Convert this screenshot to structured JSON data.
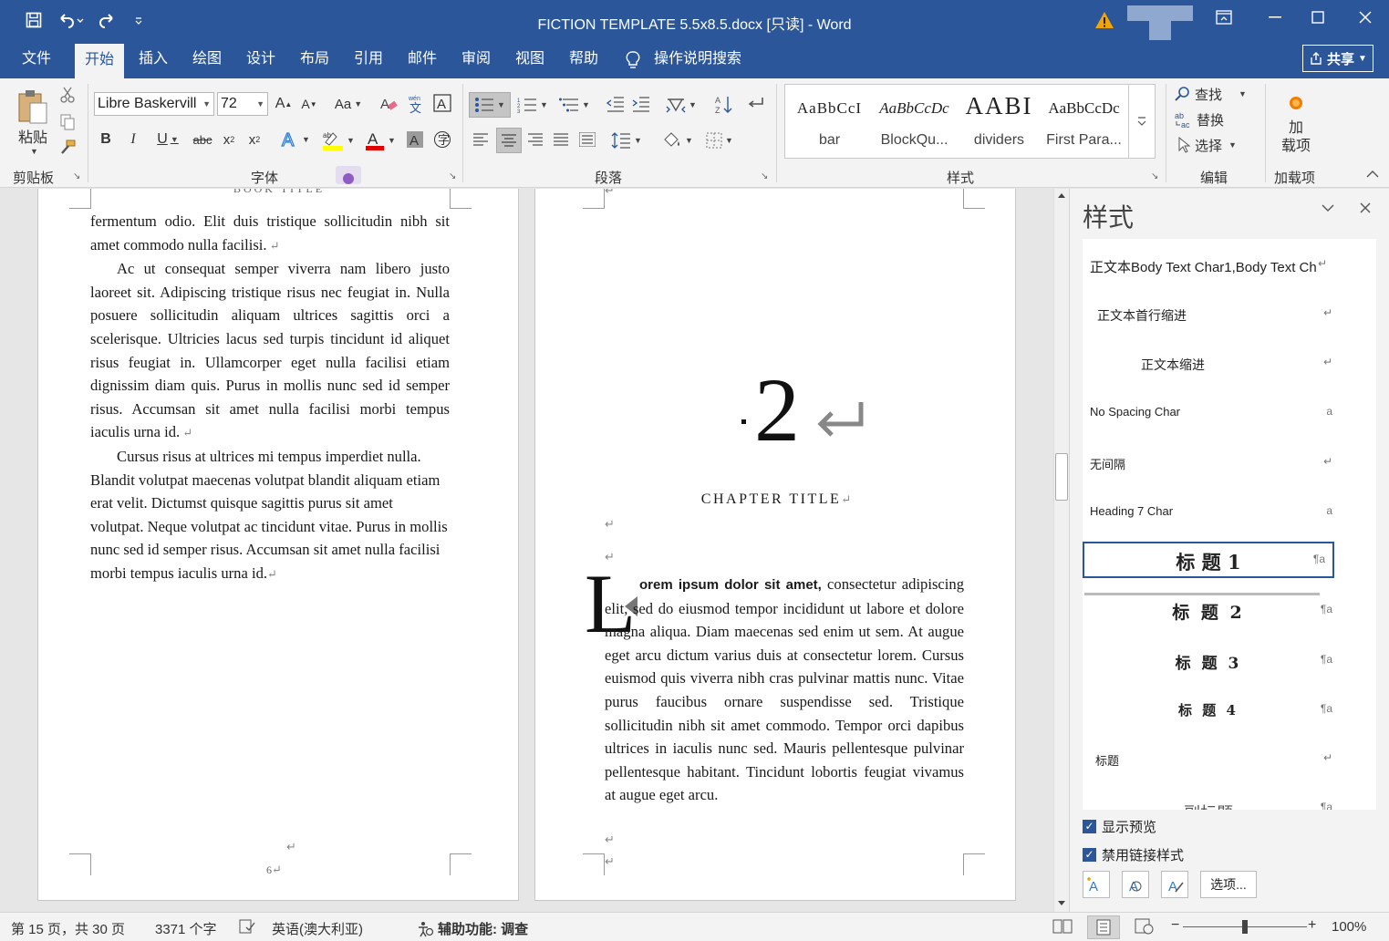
{
  "titlebar": {
    "title": "FICTION TEMPLATE 5.5x8.5.docx [只读]  -  Word",
    "qat": [
      "save-icon",
      "undo-icon",
      "redo-icon",
      "customize-icon"
    ],
    "accent": "#2b579a",
    "warning_color": "#f0a30a"
  },
  "tabs": [
    "文件",
    "开始",
    "插入",
    "绘图",
    "设计",
    "布局",
    "引用",
    "邮件",
    "审阅",
    "视图",
    "帮助"
  ],
  "active_tab": "开始",
  "tell_me": "操作说明搜索",
  "share": "共享",
  "ribbon": {
    "clipboard": {
      "label": "剪贴板",
      "paste": "粘贴"
    },
    "font": {
      "label": "字体",
      "font_name": "Libre Baskervill",
      "font_size": "72"
    },
    "paragraph": {
      "label": "段落"
    },
    "styles": {
      "label": "样式",
      "gallery": [
        {
          "preview": "AaBbCcI",
          "name": "bar"
        },
        {
          "preview": "AaBbCcDc",
          "name": "BlockQu..."
        },
        {
          "preview": "AABI",
          "name": "dividers"
        },
        {
          "preview": "AaBbCcDc",
          "name": "First Para..."
        }
      ]
    },
    "editing": {
      "label": "编辑",
      "find": "查找",
      "replace": "替换",
      "select": "选择"
    },
    "addins": {
      "label": "加载项",
      "button": "加\n载项"
    }
  },
  "page_left": {
    "header": "BOOK TITLE",
    "p1": "fermentum odio. Elit duis tristique sollicitudin nibh sit amet commodo nulla facilisi.",
    "p2": "Ac ut consequat semper viverra nam libero justo laoreet sit. Adipiscing tristique risus nec feugiat in. Nulla posuere sollicitudin aliquam ultrices sagittis orci a scelerisque. Ultricies lacus sed turpis tincidunt id aliquet risus feugiat in. Ullamcorper eget nulla facilisi etiam dignissim diam quis. Purus in mollis nunc sed id semper risus. Accumsan sit amet nulla facilisi morbi tempus iaculis urna id.",
    "p3": "Cursus risus at ultrices mi tempus imperdiet nulla. Blandit volutpat maecenas volutpat blandit aliquam etiam erat velit. Dictumst quisque sagittis purus sit amet volutpat. Neque volutpat ac tincidunt vitae. Purus in mollis nunc sed id semper risus. Accumsan sit amet nulla facilisi morbi tempus iaculis urna id.",
    "page_number": "6"
  },
  "page_right": {
    "chapter_number": "2",
    "chapter_title": "CHAPTER TITLE",
    "dropcap": "L",
    "lead_bold": "orem ipsum dolor sit amet,",
    "body": " consectetur adipiscing elit, sed do eiusmod tempor incididunt ut labore et dolore magna aliqua. Diam maecenas sed enim ut sem. At augue eget arcu dictum varius duis at consectetur lorem. Cursus euismod quis viverra nibh cras pulvinar mattis nunc. Vitae purus faucibus ornare suspendisse sed. Tristique sollicitudin nibh sit amet commodo. Tempor orci dapibus ultrices in iaculis nunc sed. Mauris pellentesque pulvinar pellentesque habitant. Tincidunt lobortis feugiat vivamus at augue eget arcu."
  },
  "styles_pane": {
    "title": "样式",
    "items": [
      {
        "name": "正文本Body Text Char1,Body Text Ch",
        "mark": "↵"
      },
      {
        "name": "正文本首行缩进",
        "mark": "↵"
      },
      {
        "name": "正文本缩进",
        "mark": "↵"
      },
      {
        "name": "No Spacing Char",
        "mark": "a"
      },
      {
        "name": "无间隔",
        "mark": "↵"
      },
      {
        "name": "Heading 7 Char",
        "mark": "a"
      },
      {
        "name": "标 题 1",
        "mark": "¶a"
      },
      {
        "name": "标 题 2",
        "mark": "¶a"
      },
      {
        "name": "标 题 3",
        "mark": "¶a"
      },
      {
        "name": "标 题 4",
        "mark": "¶a"
      },
      {
        "name": "标题",
        "mark": "↵"
      },
      {
        "name": "副标题",
        "mark": "¶a"
      }
    ],
    "show_preview": "显示预览",
    "disable_linked": "禁用链接样式",
    "options": "选项..."
  },
  "status": {
    "page": "第 15 页，共 30 页",
    "words": "3371 个字",
    "language": "英语(澳大利亚)",
    "accessibility": "辅助功能: 调查",
    "zoom": "100%",
    "zoom_level": 0.5
  }
}
